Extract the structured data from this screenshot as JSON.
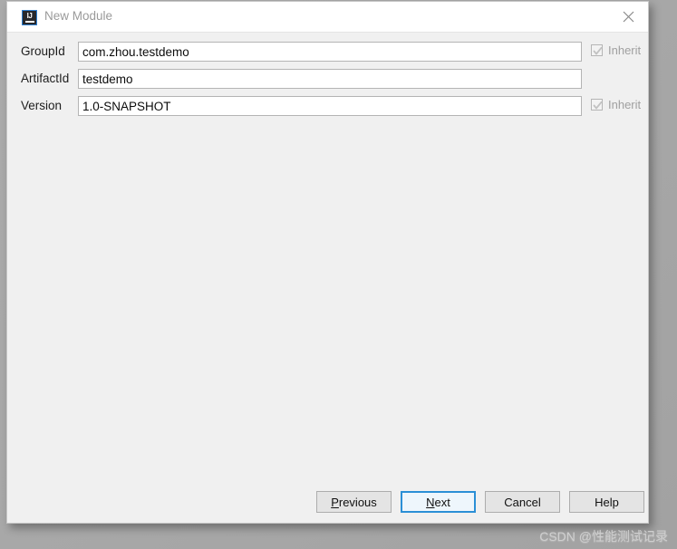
{
  "window": {
    "title": "New Module",
    "icon": "intellij-idea-icon",
    "close_icon": "close-icon"
  },
  "form": {
    "fields": [
      {
        "label": "GroupId",
        "value": "com.zhou.testdemo",
        "placeholder": "",
        "inherit": {
          "label": "Inherit",
          "checked": true,
          "enabled": false
        }
      },
      {
        "label": "ArtifactId",
        "value": "testdemo",
        "placeholder": "",
        "inherit": null
      },
      {
        "label": "Version",
        "value": "1.0-SNAPSHOT",
        "placeholder": "",
        "inherit": {
          "label": "Inherit",
          "checked": true,
          "enabled": false
        }
      }
    ]
  },
  "buttons": {
    "previous": {
      "label": "Previous",
      "mnemonic": "P",
      "before": "",
      "after": "revious"
    },
    "next": {
      "label": "Next",
      "mnemonic": "N",
      "before": "",
      "after": "ext",
      "default": true
    },
    "cancel": {
      "label": "Cancel"
    },
    "help": {
      "label": "Help"
    }
  },
  "watermark": {
    "text": "CSDN @性能测试记录"
  },
  "colors": {
    "accent": "#2b8fd6",
    "dialog_bg": "#f0f0f0",
    "titlebar_bg": "#ffffff",
    "desktop_bg": "#a9a9a9",
    "label_text": "#1d1d1d",
    "title_text": "#9a9a9a",
    "disabled_text": "#a0a0a0"
  }
}
